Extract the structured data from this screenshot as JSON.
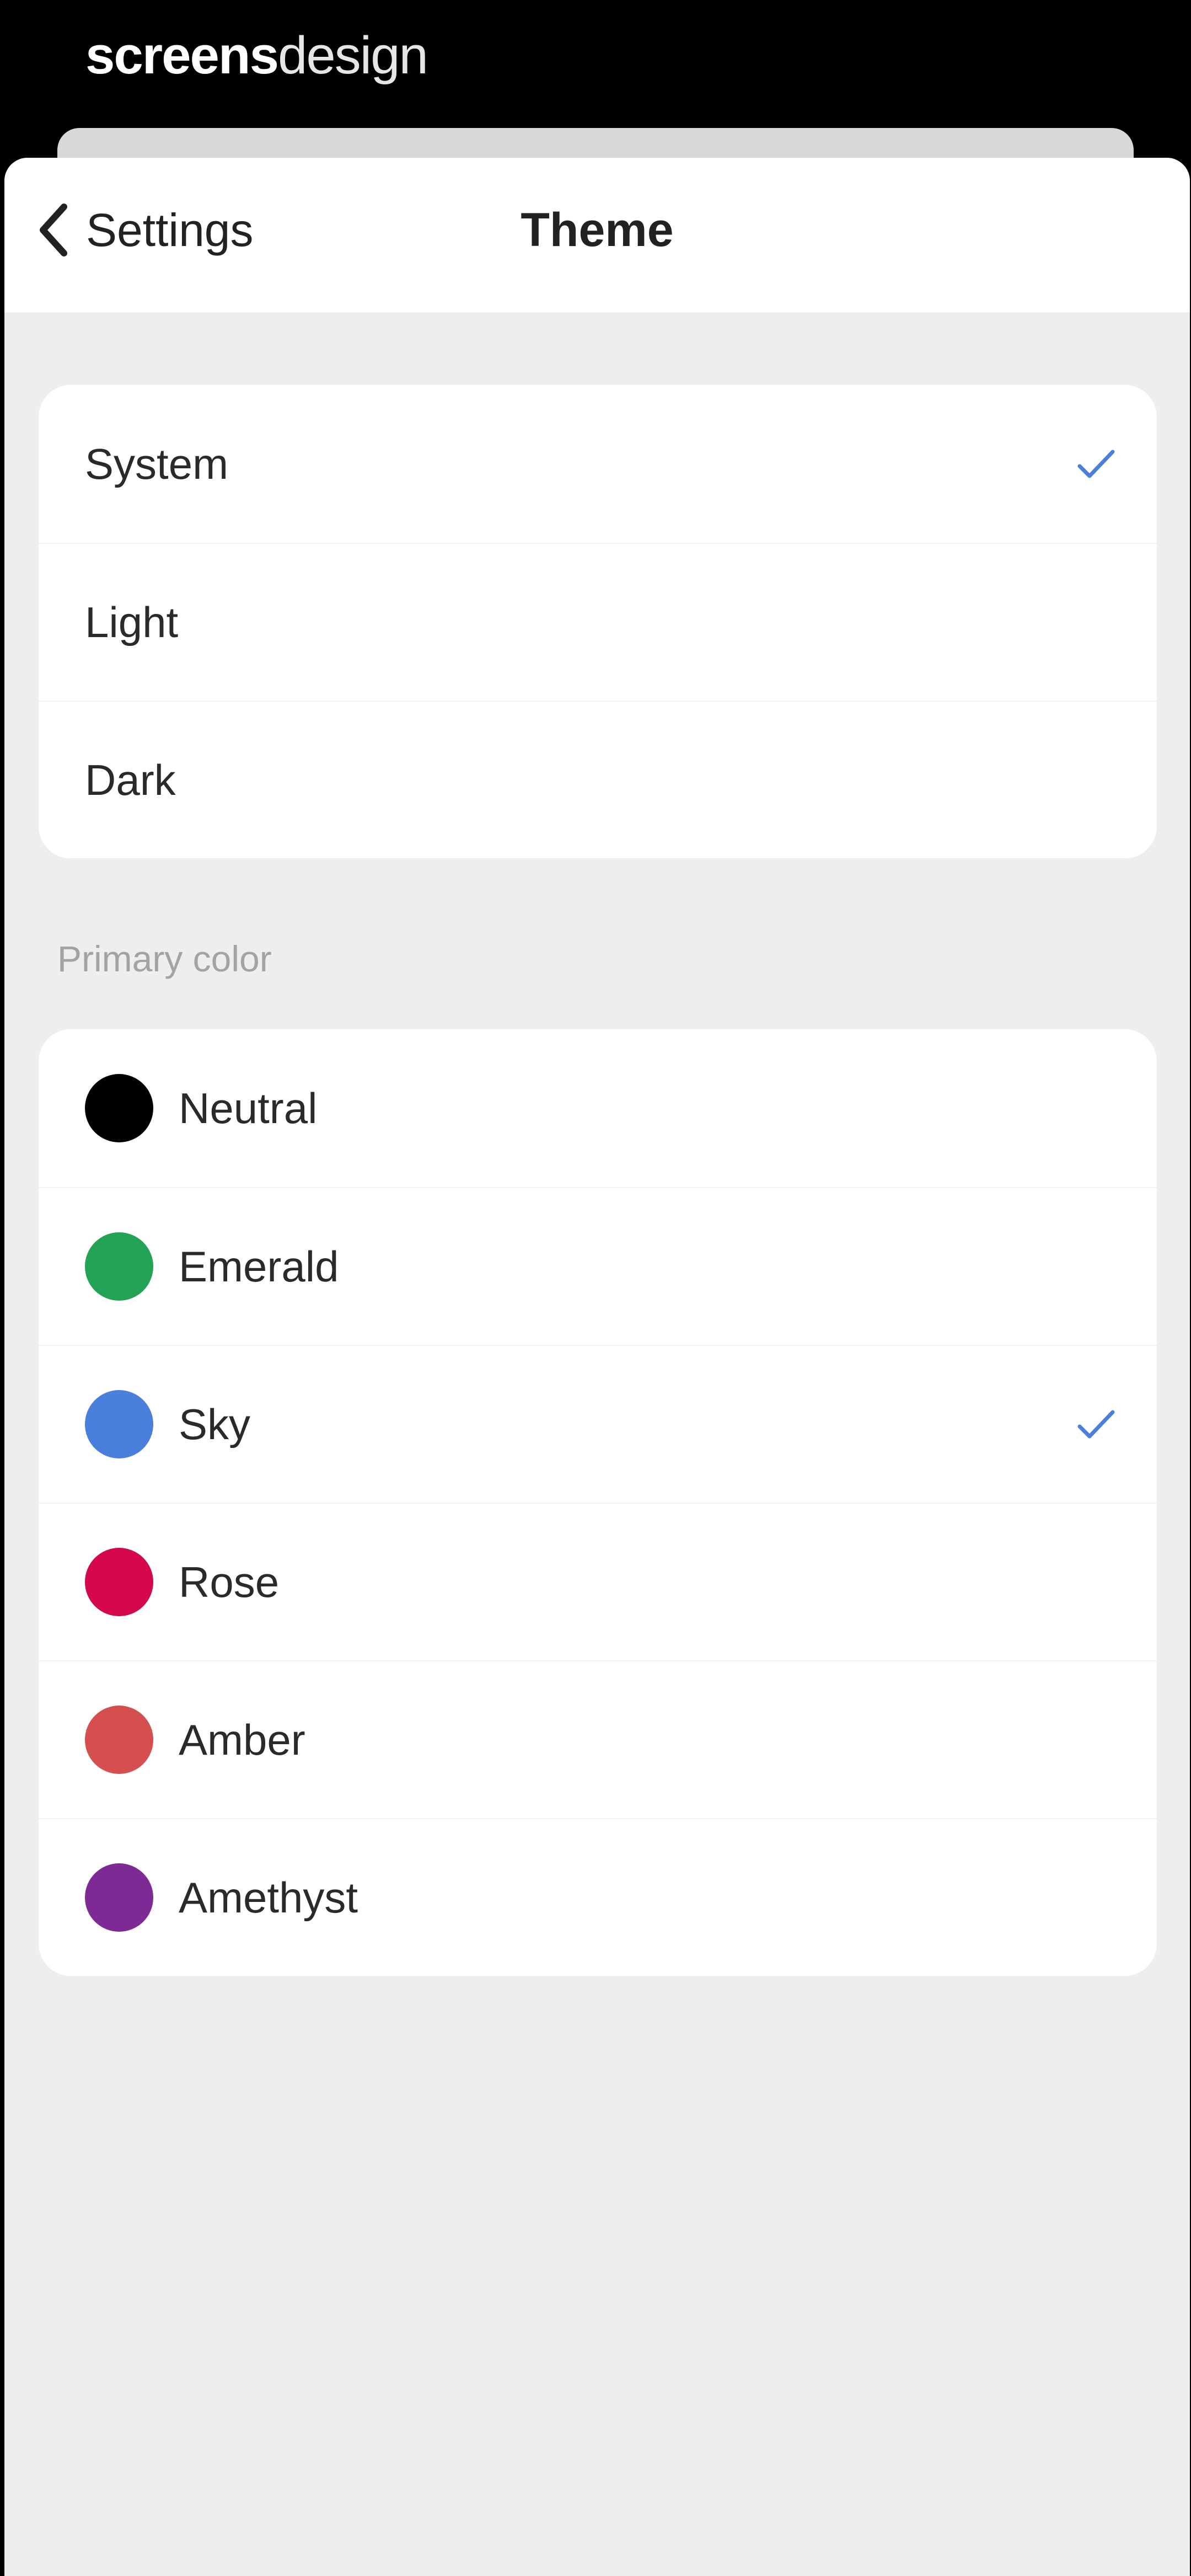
{
  "brand": {
    "bold": "screens",
    "light": "design"
  },
  "nav": {
    "back_label": "Settings",
    "title": "Theme"
  },
  "theme_options": [
    {
      "label": "System",
      "selected": true
    },
    {
      "label": "Light",
      "selected": false
    },
    {
      "label": "Dark",
      "selected": false
    }
  ],
  "color_section": {
    "label": "Primary color"
  },
  "color_options": [
    {
      "label": "Neutral",
      "color": "#000000",
      "selected": false
    },
    {
      "label": "Emerald",
      "color": "#22a355",
      "selected": false
    },
    {
      "label": "Sky",
      "color": "#4a7fdc",
      "selected": true
    },
    {
      "label": "Rose",
      "color": "#d4064e",
      "selected": false
    },
    {
      "label": "Amber",
      "color": "#d54f4f",
      "selected": false
    },
    {
      "label": "Amethyst",
      "color": "#7e2a95",
      "selected": false
    }
  ],
  "colors": {
    "accent": "#4a7fdc",
    "sheet_background": "#eeeeee",
    "card_background": "#ffffff",
    "section_label": "#a3a3a3"
  },
  "icons": {
    "back": "chevron-left-icon",
    "selected": "check-icon"
  }
}
